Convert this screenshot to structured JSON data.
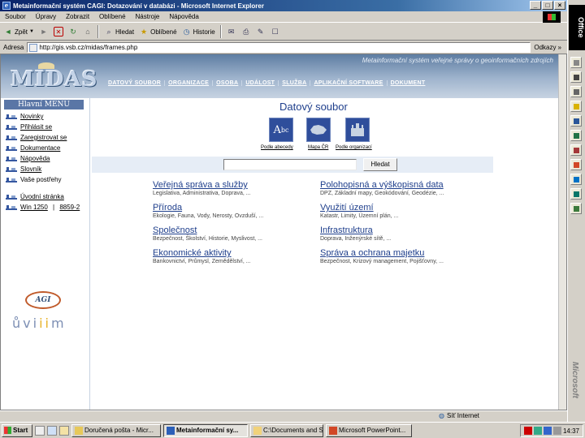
{
  "window": {
    "title": "Metainformační systém CAGI: Dotazování v databázi - Microsoft Internet Explorer",
    "buttons": [
      "_",
      "□",
      "×"
    ]
  },
  "menubar": [
    "Soubor",
    "Úpravy",
    "Zobrazit",
    "Oblíbené",
    "Nástroje",
    "Nápověda"
  ],
  "toolbar": {
    "back": "Zpět",
    "search": "Hledat",
    "favorites": "Oblíbené",
    "history": "Historie"
  },
  "address": {
    "label": "Adresa",
    "value": "http://gis.vsb.cz/midas/frames.php",
    "go_label": "Odkazy",
    "go_suffix": "»"
  },
  "site": {
    "portal_title": "Metainformační systém veřejné správy o geoinformačních zdrojích",
    "logo": "MIDAS",
    "topnav": [
      "DATOVÝ SOUBOR",
      "ORGANIZACE",
      "OSOBA",
      "UDÁLOST",
      "SLUŽBA",
      "APLIKAČNÍ SOFTWARE",
      "DOKUMENT"
    ]
  },
  "leftmenu": {
    "title": "Hlavní MENU",
    "items": [
      "Novinky",
      "Přihlásit se",
      "Zaregistrovat se",
      "Dokumentace",
      "Nápověda",
      "Slovník",
      "Vaše postřehy"
    ],
    "home": "Úvodní stránka",
    "version": "Win 1250",
    "version_sep": " | ",
    "encoding": "8859-2",
    "agi_logo": "AGI",
    "uvim_logo_left": "ůvi",
    "uvim_logo_mid": "ii",
    "uvim_logo_right": "m"
  },
  "main": {
    "heading": "Datový soubor",
    "search_options": [
      "Podle abecedy",
      "Mapa ČR",
      "Podle organizací"
    ],
    "search_button": "Hledat",
    "categories": [
      {
        "title": "Veřejná správa a služby",
        "sub": "Legislativa, Administrativa, Doprava, ..."
      },
      {
        "title": "Polohopisná a výškopisná data",
        "sub": "DPZ, Základní mapy, Geokódování, Geodézie, ..."
      },
      {
        "title": "Příroda",
        "sub": "Ekologie, Fauna, Vody, Nerosty, Ovzduší, ..."
      },
      {
        "title": "Využití území",
        "sub": "Katastr, Limity, Územní plán, ..."
      },
      {
        "title": "Společnost",
        "sub": "Bezpečnost, Školství, Historie, Myslivost, ..."
      },
      {
        "title": "Infrastruktura",
        "sub": "Doprava, Inženýrské sítě, ..."
      },
      {
        "title": "Ekonomické aktivity",
        "sub": "Bankovnictví, Průmysl, Zemědělství, ..."
      },
      {
        "title": "Správa a ochrana majetku",
        "sub": "Bezpečnost, Krizový management, Pojišťovny, ..."
      }
    ]
  },
  "status": {
    "zone": "Síť Internet"
  },
  "officebar": {
    "label": "Office",
    "vendor": "Microsoft"
  },
  "taskbar": {
    "start": "Start",
    "tasks": [
      "Doručená pošta - Micr...",
      "Metainformační sy...",
      "C:\\Documents and Se...",
      "Microsoft PowerPoint..."
    ],
    "clock": "14:37"
  },
  "colors": {
    "accent": "#1f3f8c",
    "header": "#5e7da2"
  }
}
